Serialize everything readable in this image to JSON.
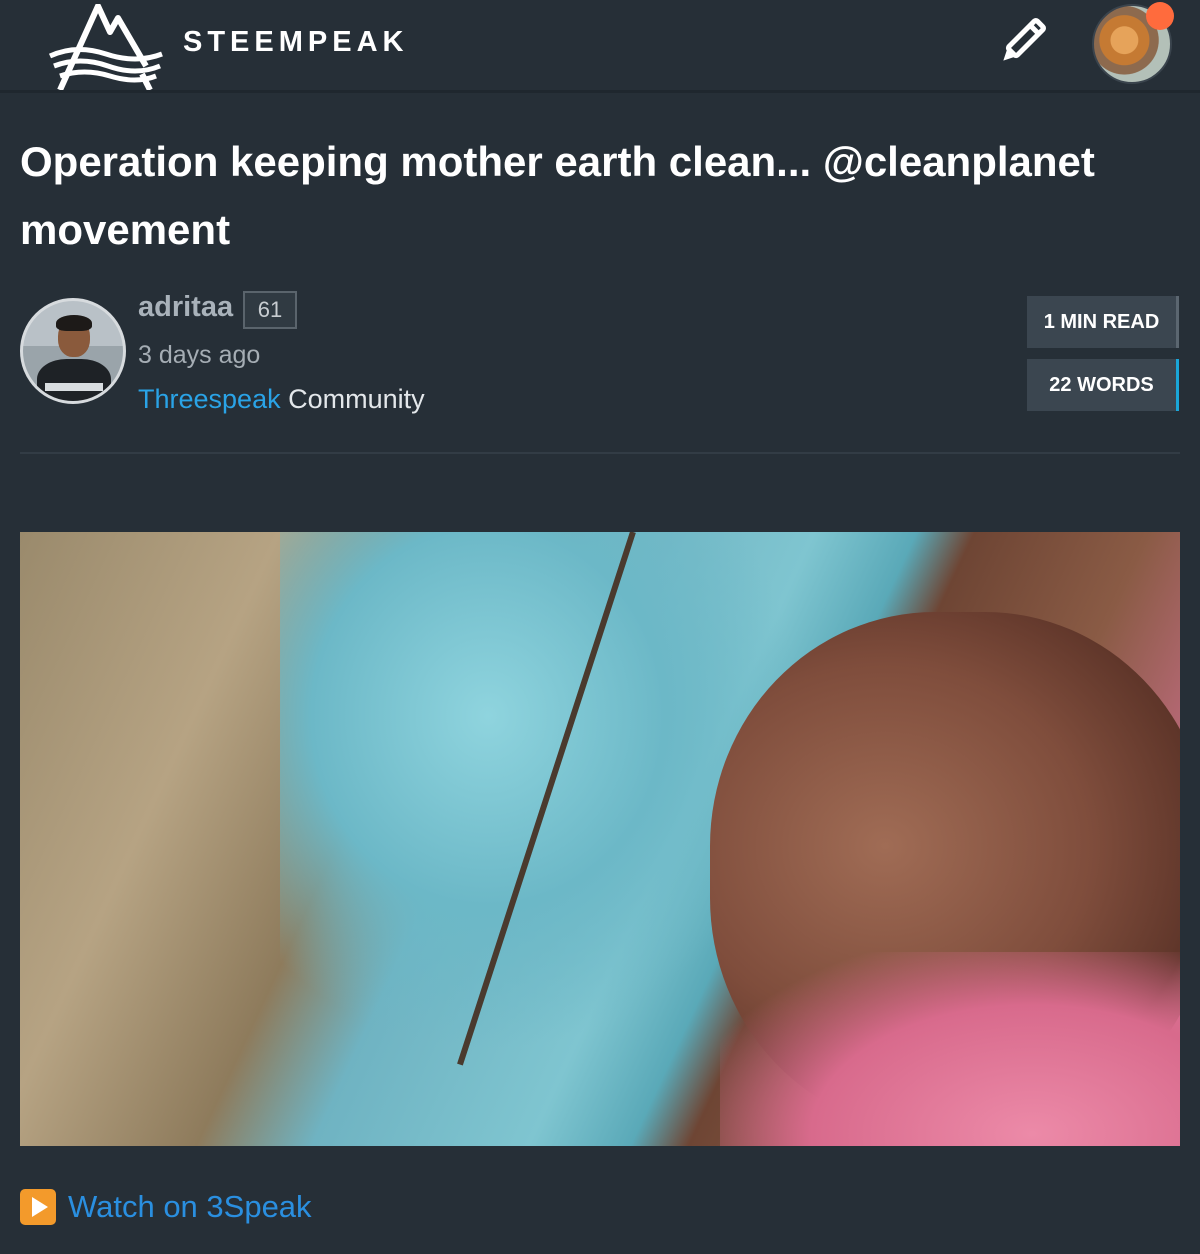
{
  "header": {
    "brand": "STEEMPEAK",
    "logo_icon": "steempeak-mountain-logo",
    "compose_icon": "pencil-icon",
    "avatar_icon": "user-avatar",
    "notification_color": "#ff6b3d"
  },
  "post": {
    "title": "Operation keeping mother earth clean... @cleanplanet movement",
    "author": {
      "name": "adritaa",
      "reputation": "61",
      "time_ago": "3 days ago"
    },
    "community": {
      "name": "Threespeak",
      "suffix": " Community"
    },
    "stats": {
      "read_time": "1 MIN READ",
      "word_count": "22 WORDS"
    },
    "video": {
      "icon": "video-thumbnail"
    },
    "watch": {
      "icon": "play-button-icon",
      "label": "Watch on 3Speak"
    }
  },
  "colors": {
    "background": "#262f37",
    "link": "#2aa3e6",
    "word_count_accent": "#1aa6d8",
    "play_icon": "#f39a2b"
  }
}
